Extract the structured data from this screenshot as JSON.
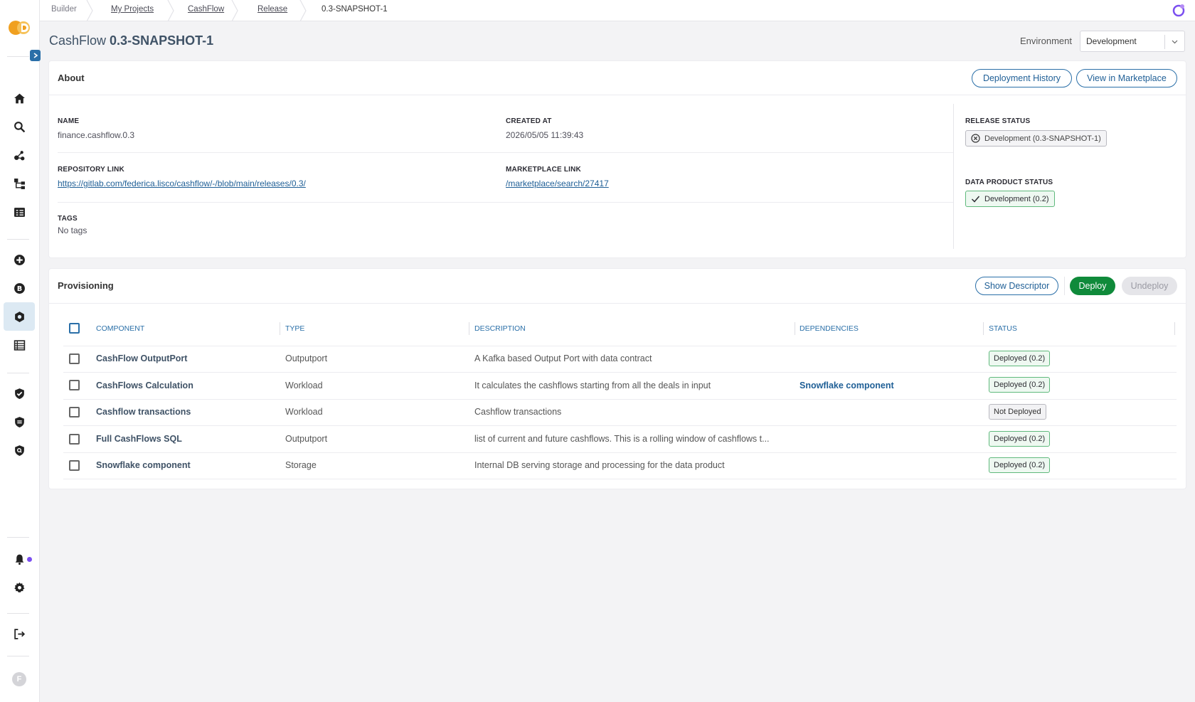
{
  "breadcrumb": {
    "items": [
      "Builder",
      "My Projects",
      "CashFlow",
      "Release",
      "0.3-SNAPSHOT-1"
    ]
  },
  "header": {
    "title_name": "CashFlow",
    "title_version": "0.3-SNAPSHOT-1",
    "environment_label": "Environment",
    "environment_value": "Development"
  },
  "about": {
    "title": "About",
    "deployment_history_label": "Deployment History",
    "view_marketplace_label": "View in Marketplace",
    "name_label": "NAME",
    "name_value": "finance.cashflow.0.3",
    "created_label": "CREATED AT",
    "created_value": "2026/05/05 11:39:43",
    "repo_label": "REPOSITORY LINK",
    "repo_value": "https://gitlab.com/federica.lisco/cashflow/-/blob/main/releases/0.3/",
    "marketplace_label": "MARKETPLACE LINK",
    "marketplace_value": "/marketplace/search/27417",
    "tags_label": "TAGS",
    "tags_value": "No tags",
    "release_status_label": "RELEASE STATUS",
    "release_status_value": "Development (0.3-SNAPSHOT-1)",
    "product_status_label": "DATA PRODUCT STATUS",
    "product_status_value": "Development (0.2)"
  },
  "provisioning": {
    "title": "Provisioning",
    "show_descriptor_label": "Show Descriptor",
    "deploy_label": "Deploy",
    "undeploy_label": "Undeploy",
    "columns": [
      "COMPONENT",
      "TYPE",
      "DESCRIPTION",
      "DEPENDENCIES",
      "STATUS"
    ],
    "rows": [
      {
        "component": "CashFlow OutputPort",
        "type": "Outputport",
        "description": "A Kafka based Output Port with data contract",
        "dependencies": "",
        "status": "Deployed (0.2)"
      },
      {
        "component": "CashFlows Calculation",
        "type": "Workload",
        "description": "It calculates the cashflows starting from all the deals in input",
        "dependencies": "Snowflake component",
        "status": "Deployed (0.2)"
      },
      {
        "component": "Cashflow transactions",
        "type": "Workload",
        "description": "Cashflow transactions",
        "dependencies": "",
        "status": "Not Deployed"
      },
      {
        "component": "Full CashFlows SQL",
        "type": "Outputport",
        "description": "list of current and future cashflows. This is a rolling window of cashflows t...",
        "dependencies": "",
        "status": "Deployed (0.2)"
      },
      {
        "component": "Snowflake component",
        "type": "Storage",
        "description": "Internal DB serving storage and processing for the data product",
        "dependencies": "",
        "status": "Deployed (0.2)"
      }
    ]
  },
  "sidebar": {
    "avatar_initial": "F",
    "icons": [
      "home-icon",
      "search-icon",
      "graph-icon",
      "hierarchy-icon",
      "list-icon",
      "plus-icon",
      "b-icon",
      "hexagon-icon",
      "table-icon",
      "shield-check-icon",
      "shield-list-icon",
      "shield-search-icon",
      "bell-icon",
      "gear-icon",
      "logout-icon"
    ]
  },
  "colors": {
    "accent": "#2a6fa8",
    "deploy_green": "#0f8a3a",
    "brand_orange": "#f0a020",
    "notification_purple": "#7b4ff0"
  }
}
